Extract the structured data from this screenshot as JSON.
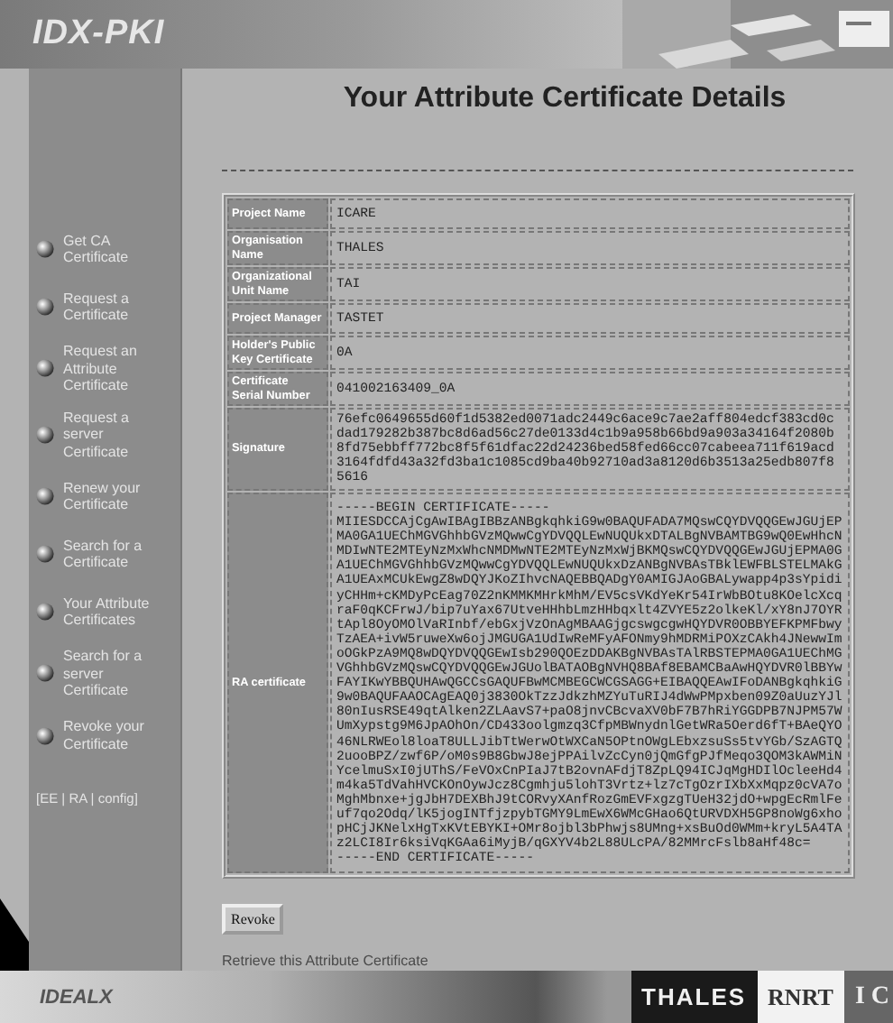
{
  "header": {
    "logo": "IDX-PKI"
  },
  "page_title": "Your Attribute Certificate Details",
  "sidebar": {
    "items": [
      {
        "label": "Get CA Certificate"
      },
      {
        "label": "Request a Certificate"
      },
      {
        "label": "Request an Attribute Certificate"
      },
      {
        "label": "Request a server Certificate"
      },
      {
        "label": "Renew your Certificate"
      },
      {
        "label": "Search for a Certificate"
      },
      {
        "label": "Your Attribute Certificates"
      },
      {
        "label": "Search for a server Certificate"
      },
      {
        "label": "Revoke your Certificate"
      }
    ],
    "footer_links": "[EE | RA | config]"
  },
  "details": [
    {
      "label": "Project Name",
      "value": "ICARE"
    },
    {
      "label": "Organisation Name",
      "value": "THALES"
    },
    {
      "label": "Organizational Unit Name",
      "value": "TAI"
    },
    {
      "label": "Project Manager",
      "value": "TASTET"
    },
    {
      "label": "Holder's Public Key Certificate",
      "value": "0A"
    },
    {
      "label": "Certificate Serial Number",
      "value": "041002163409_0A"
    },
    {
      "label": "Signature",
      "value": "76efc0649655d60f1d5382ed0071adc2449c6ace9c7ae2aff804edcf383cd0cdad179282b387bc8d6ad56c27de0133d4c1b9a958b66bd9a903a34164f2080b8fd75ebbff772bc8f5f61dfac22d24236bed58fed66cc07cabeea711f619acd3164fdfd43a32fd3ba1c1085cd9ba40b92710ad3a8120d6b3513a25edb807f85616"
    },
    {
      "label": "RA certificate",
      "lines": [
        "-----BEGIN CERTIFICATE-----",
        "MIIESDCCAjCgAwIBAgIBBzANBgkqhkiG9w0BAQUFADA7MQswCQYDVQQGEwJGUjEP",
        "MA0GA1UEChMGVGhhbGVzMQwwCgYDVQQLEwNUQUkxDTALBgNVBAMTBG9wQ0EwHhcN",
        "MDIwNTE2MTEyNzMxWhcNMDMwNTE2MTEyNzMxWjBKMQswCQYDVQQGEwJGUjEPMA0G",
        "A1UEChMGVGhhbGVzMQwwCgYDVQQLEwNUQUkxDzANBgNVBAsTBklEWFBLSTELMAkG",
        "A1UEAxMCUkEwgZ8wDQYJKoZIhvcNAQEBBQADgY0AMIGJAoGBALywapp4p3sYpidi",
        "yCHHm+cKMDyPcEag70Z2nKMMKMHrkMhM/EV5csVKdYeKr54IrWbBOtu8KOelcXcq",
        "raF0qKCFrwJ/bip7uYax67UtveHHhbLmzHHbqxlt4ZVYE5z2olkeKl/xY8nJ7OYR",
        "tApl8OyOMOlVaRInbf/ebGxjVzOnAgMBAAGjgcswgcgwHQYDVR0OBBYEFKPMFbwy",
        "TzAEA+ivW5ruweXw6ojJMGUGA1UdIwReMFyAFONmy9hMDRMiPOXzCAkh4JNewwIm",
        "oOGkPzA9MQ8wDQYDVQQGEwIsb290QOEzDDAKBgNVBAsTAlRBSTEPMA0GA1UEChMG",
        "VGhhbGVzMQswCQYDVQQGEwJGUolBATAOBgNVHQ8BAf8EBAMCBaAwHQYDVR0lBBYw",
        "FAYIKwYBBQUHAwQGCCsGAQUFBwMCMBEGCWCGSAGG+EIBAQQEAwIFoDANBgkqhkiG",
        "9w0BAQUFAAOCAgEAQ0j3830OkTzzJdkzhMZYuTuRIJ4dWwPMpxben09Z0aUuzYJl",
        "80nIusRSE49qtAlken2ZLAavS7+paO8jnvCBcvaXV0bF7B7hRiYGGDPB7NJPM57W",
        "UmXypstg9M6JpAOhOn/CD433oolgmzq3CfpMBWnydnlGetWRa5Oerd6fT+BAeQYO",
        "46NLRWEol8loaT8ULLJibTtWerwOtWXCaN5OPtnOWgLEbxzsuSs5tvYGb/SzAGTQ",
        "2uooBPZ/zwf6P/oM0s9B8GbwJ8ejPPAilvZcCyn0jQmGfgPJfMeqo3QOM3kAWMiN",
        "YcelmuSxI0jUThS/FeVOxCnPIaJ7tB2ovnAFdjT8ZpLQ94ICJqMgHDIlOcleeHd4",
        "m4ka5TdVahHVCKOnOywJcz8Cgmhju5lohT3Vrtz+lz7cTgOzrIXbXxMqpz0cVA7o",
        "MghMbnxe+jgJbH7DEXBhJ9tCORvyXAnfRozGmEVFxgzgTUeH32jdO+wpgEcRmlFe",
        "uf7qo2Odq/lK5jogINTfjzpybTGMY9LmEwX6WMcGHao6QtURVDXH5GP8noWg6xho",
        "pHCjJKNelxHgTxKVtEBYKI+OMr8ojbl3bPhwjs8UMng+xsBuOd0WMm+kryL5A4TA",
        "z2LCI8Ir6ksiVqKGAa6iMyjB/qGXYV4b2L88ULcPA/82MMrcFslb8aHf48c=",
        "-----END CERTIFICATE-----"
      ]
    }
  ],
  "revoke_button": "Revoke",
  "retrieve_link": "Retrieve this Attribute Certificate",
  "footer": {
    "logos": [
      {
        "kind": "script",
        "text": "IDEALX"
      },
      {
        "kind": "dark",
        "text": "THALES"
      },
      {
        "kind": "light",
        "text": "RNRT"
      },
      {
        "kind": "partial",
        "text": "I C"
      }
    ]
  }
}
